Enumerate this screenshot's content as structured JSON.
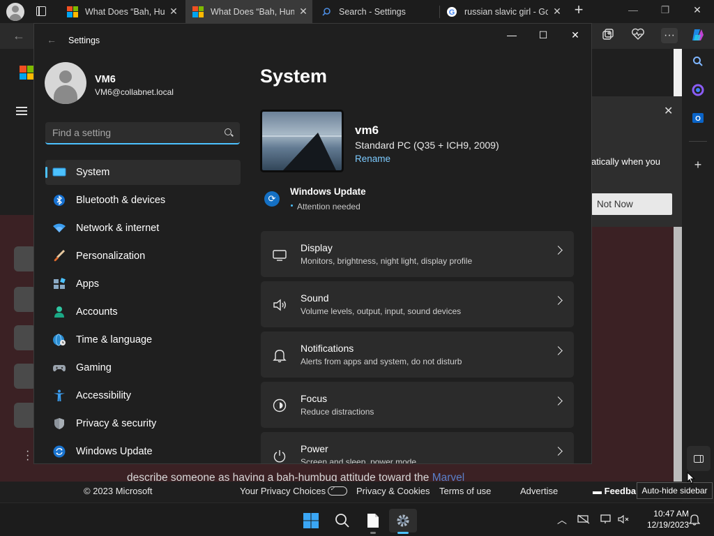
{
  "browser": {
    "tabs": [
      {
        "title": "What Does “Bah, Hum",
        "favicon": "microsoft-logo",
        "active": false
      },
      {
        "title": "What Does “Bah, Hum",
        "favicon": "microsoft-logo",
        "active": true
      },
      {
        "title": "Search - Settings",
        "favicon": "search-icon",
        "active": false
      },
      {
        "title": "russian slavic girl - Go",
        "favicon": "google-logo",
        "active": false
      }
    ],
    "tab_close": "✕",
    "new_tab": "+",
    "window_controls": {
      "minimize": "—",
      "restore": "❐",
      "close": "✕"
    }
  },
  "webpage": {
    "popup_text": "atically when you",
    "popup_button": "Not Now",
    "body_text": "describe someone as having a bah-humbug attitude toward the",
    "body_link": "Marvel",
    "footer": {
      "copyright": "© 2023 Microsoft",
      "privacy_choices": "Your Privacy Choices",
      "privacy_cookies": "Privacy & Cookies",
      "terms": "Terms of use",
      "advertise": "Advertise",
      "feedback": "Feedba"
    },
    "tooltip": "Auto-hide sidebar"
  },
  "settings": {
    "window_title": "Settings",
    "user": {
      "name": "VM6",
      "email": "VM6@collabnet.local"
    },
    "search_placeholder": "Find a setting",
    "nav": [
      {
        "label": "System",
        "icon": "system-icon",
        "selected": true
      },
      {
        "label": "Bluetooth & devices",
        "icon": "bluetooth-icon",
        "selected": false
      },
      {
        "label": "Network & internet",
        "icon": "wifi-icon",
        "selected": false
      },
      {
        "label": "Personalization",
        "icon": "brush-icon",
        "selected": false
      },
      {
        "label": "Apps",
        "icon": "apps-icon",
        "selected": false
      },
      {
        "label": "Accounts",
        "icon": "accounts-icon",
        "selected": false
      },
      {
        "label": "Time & language",
        "icon": "globe-clock-icon",
        "selected": false
      },
      {
        "label": "Gaming",
        "icon": "gamepad-icon",
        "selected": false
      },
      {
        "label": "Accessibility",
        "icon": "accessibility-icon",
        "selected": false
      },
      {
        "label": "Privacy & security",
        "icon": "shield-icon",
        "selected": false
      },
      {
        "label": "Windows Update",
        "icon": "windows-update-icon",
        "selected": false
      }
    ],
    "main": {
      "title": "System",
      "device_name": "vm6",
      "device_model": "Standard PC (Q35 + ICH9, 2009)",
      "rename": "Rename",
      "windows_update": {
        "title": "Windows Update",
        "status": "Attention needed"
      },
      "cards": [
        {
          "title": "Display",
          "desc": "Monitors, brightness, night light, display profile",
          "icon": "monitor-icon"
        },
        {
          "title": "Sound",
          "desc": "Volume levels, output, input, sound devices",
          "icon": "speaker-icon"
        },
        {
          "title": "Notifications",
          "desc": "Alerts from apps and system, do not disturb",
          "icon": "bell-icon"
        },
        {
          "title": "Focus",
          "desc": "Reduce distractions",
          "icon": "focus-icon"
        },
        {
          "title": "Power",
          "desc": "Screen and sleep, power mode",
          "icon": "power-icon"
        }
      ]
    }
  },
  "taskbar": {
    "time": "10:47 AM",
    "date": "12/19/2023"
  },
  "colors": {
    "accent": "#4cc2ff",
    "settings_bg": "#1f1f1f",
    "card_bg": "#2b2b2b",
    "taskbar_bg": "#1c1c1c"
  }
}
